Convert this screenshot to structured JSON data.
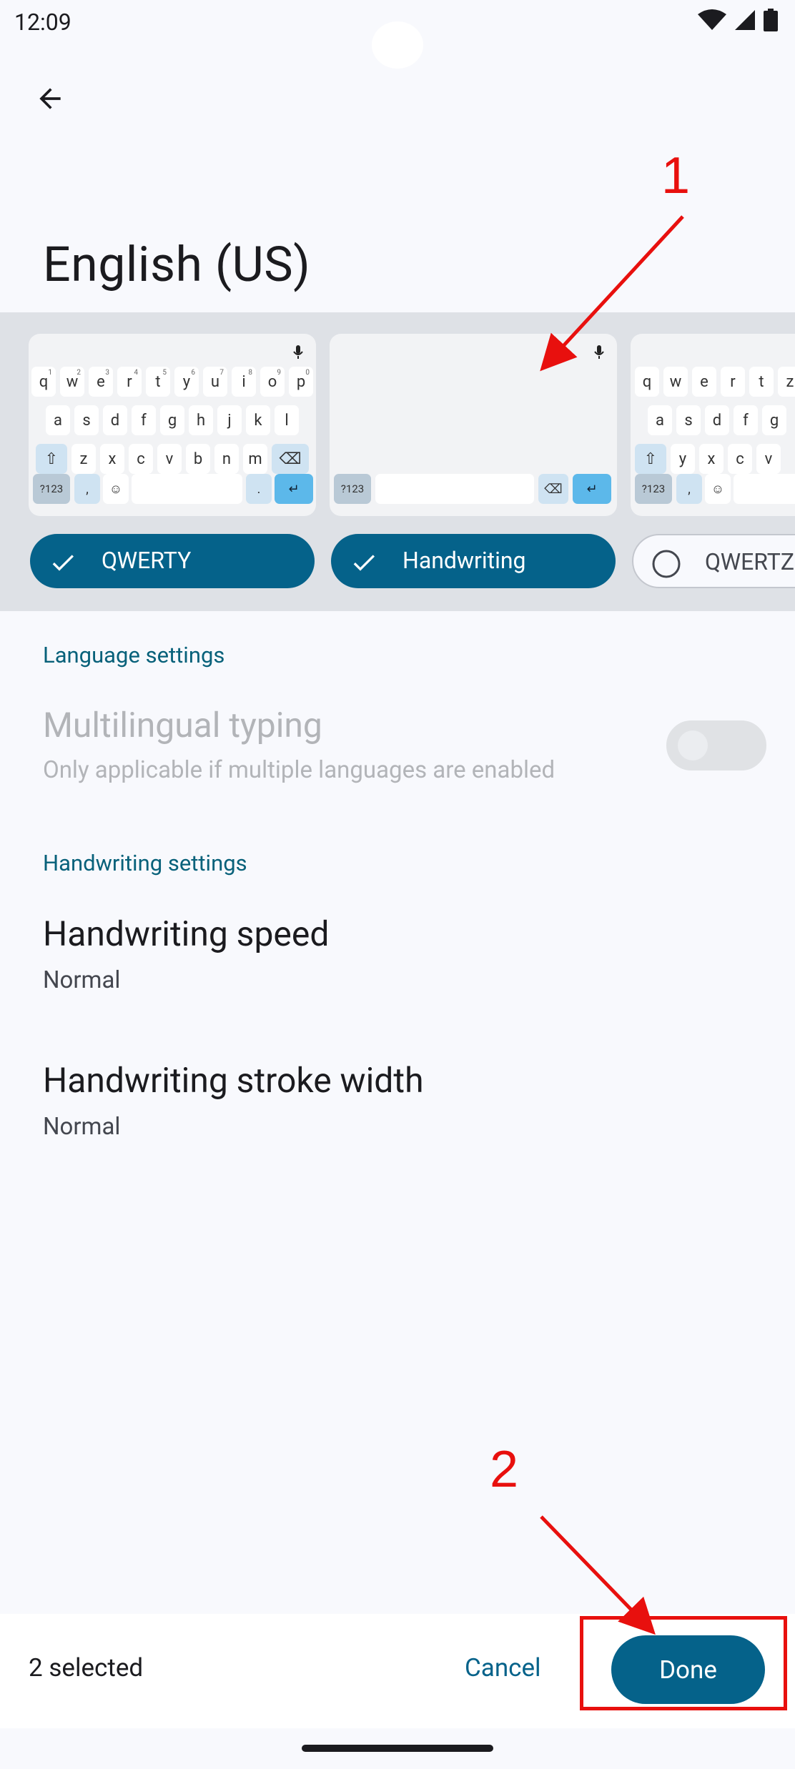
{
  "status_bar": {
    "time": "12:09",
    "icons": [
      "wifi-icon",
      "cell-signal-icon",
      "battery-icon"
    ]
  },
  "app_bar": {
    "back_icon": "arrow-back-icon",
    "title": "English (US)"
  },
  "layouts": [
    {
      "label": "QWERTY",
      "selected": true
    },
    {
      "label": "Handwriting",
      "selected": true
    },
    {
      "label": "QWERTZ",
      "selected": false
    }
  ],
  "keyboard_preview": {
    "row1": [
      "q",
      "w",
      "e",
      "r",
      "t",
      "y",
      "u",
      "i",
      "o",
      "p"
    ],
    "row1_hints": [
      "1",
      "2",
      "3",
      "4",
      "5",
      "6",
      "7",
      "8",
      "9",
      "0"
    ],
    "row2": [
      "a",
      "s",
      "d",
      "f",
      "g",
      "h",
      "j",
      "k",
      "l"
    ],
    "row3": [
      "z",
      "x",
      "c",
      "v",
      "b",
      "n",
      "m"
    ],
    "symbols_key": "?123",
    "comma_key": ",",
    "period_key": "."
  },
  "language_settings": {
    "header": "Language settings",
    "multilingual_title": "Multilingual typing",
    "multilingual_summary": "Only applicable if multiple languages are enabled",
    "multilingual_enabled": false
  },
  "handwriting_settings": {
    "header": "Handwriting settings",
    "speed_title": "Handwriting speed",
    "speed_value": "Normal",
    "stroke_title": "Handwriting stroke width",
    "stroke_value": "Normal"
  },
  "bottom_bar": {
    "selected_count": "2 selected",
    "cancel_label": "Cancel",
    "done_label": "Done"
  },
  "annotations": {
    "step1": "1",
    "step2": "2"
  },
  "colors": {
    "accent": "#05628a",
    "annotation": "#e8100e",
    "band": "#dee1e6"
  }
}
